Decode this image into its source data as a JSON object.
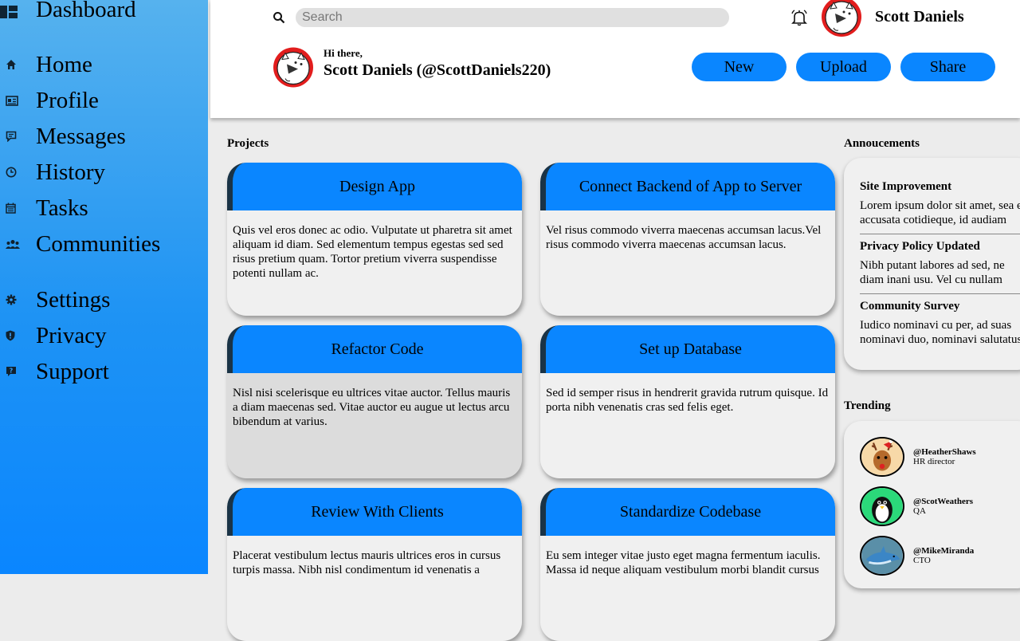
{
  "sidebar": {
    "brand": "Dashboard",
    "items": [
      {
        "label": "Home",
        "icon": "home-icon"
      },
      {
        "label": "Profile",
        "icon": "id-card-icon"
      },
      {
        "label": "Messages",
        "icon": "message-icon"
      },
      {
        "label": "History",
        "icon": "clock-icon"
      },
      {
        "label": "Tasks",
        "icon": "calendar-icon"
      },
      {
        "label": "Communities",
        "icon": "users-icon"
      },
      {
        "label": "Settings",
        "icon": "gear-icon"
      },
      {
        "label": "Privacy",
        "icon": "shield-icon"
      },
      {
        "label": "Support",
        "icon": "help-icon"
      }
    ]
  },
  "header": {
    "search_placeholder": "Search",
    "user_name": "Scott Daniels",
    "greeting": "Hi there,",
    "greeting_name": "Scott Daniels (@ScottDaniels220)",
    "buttons": {
      "new": "New",
      "upload": "Upload",
      "share": "Share"
    }
  },
  "projects": {
    "title": "Projects",
    "cards": [
      {
        "title": "Design App",
        "text": "Quis vel eros donec ac odio. Vulputate ut pharetra sit amet aliquam id diam. Sed elementum tempus egestas sed sed risus pretium quam. Tortor pretium viverra suspendisse potenti nullam ac."
      },
      {
        "title": "Connect Backend of App to Server",
        "text": "Vel risus commodo viverra maecenas accumsan lacus.Vel risus commodo viverra maecenas accumsan lacus."
      },
      {
        "title": "Refactor Code",
        "text": "Nisl nisi scelerisque eu ultrices vitae auctor. Tellus mauris a diam maecenas sed. Vitae auctor eu augue ut lectus arcu bibendum at varius."
      },
      {
        "title": "Set up Database",
        "text": "Sed id semper risus in hendrerit gravida rutrum quisque. Id porta nibh venenatis cras sed felis eget."
      },
      {
        "title": "Review With Clients",
        "text": "Placerat vestibulum lectus mauris ultrices eros in cursus turpis massa. Nibh nisl condimentum id venenatis a"
      },
      {
        "title": "Standardize Codebase",
        "text": "Eu sem integer vitae justo eget magna fermentum iaculis. Massa id neque aliquam vestibulum morbi blandit cursus"
      }
    ]
  },
  "announcements": {
    "title": "Annoucements",
    "items": [
      {
        "title": "Site Improvement",
        "text": "Lorem ipsum dolor sit amet, sea ei accusata cotidieque, id audiam labitur quo. In primis"
      },
      {
        "title": "Privacy Policy Updated",
        "text": "Nibh putant labores ad sed, ne diam inani usu. Vel cu nullam salutatus, integre facilis"
      },
      {
        "title": "Community Survey",
        "text": "Iudico nominavi cu per, ad suas nominavi duo, nominavi salutatus sententiae vim ea. Eos"
      }
    ]
  },
  "trending": {
    "title": "Trending",
    "items": [
      {
        "handle": "@HeatherShaws",
        "role": "HR director",
        "avatar": "reindeer-avatar",
        "color": "#f7d9a8"
      },
      {
        "handle": "@ScotWeathers",
        "role": "QA",
        "avatar": "penguin-avatar",
        "color": "#2bd97a"
      },
      {
        "handle": "@MikeMiranda",
        "role": "CTO",
        "avatar": "dolphin-avatar",
        "color": "#5a8fa8"
      }
    ]
  },
  "colors": {
    "accent": "#0a86ff",
    "card_border": "#1a3346",
    "background": "#ececec"
  }
}
